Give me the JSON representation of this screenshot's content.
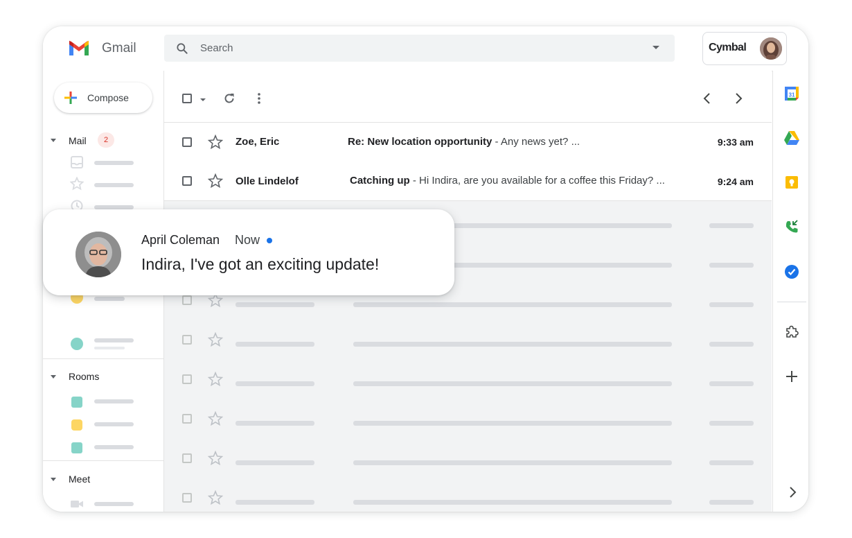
{
  "app": {
    "name": "Gmail"
  },
  "search": {
    "placeholder": "Search"
  },
  "account": {
    "org": "Cymbal"
  },
  "sidebar": {
    "compose_label": "Compose",
    "sections": {
      "mail": "Mail",
      "rooms": "Rooms",
      "meet": "Meet"
    },
    "mail_badge": "2"
  },
  "emails": [
    {
      "sender": "Zoe, Eric",
      "subject": "Re: New location opportunity",
      "snippet": " - Any news yet? ...",
      "time": "9:33 am"
    },
    {
      "sender": "Olle Lindelof",
      "subject": "Catching up",
      "snippet": " - Hi Indira, are you available for a coffee this Friday? ...",
      "time": "9:24 am"
    }
  ],
  "notification": {
    "sender": "April Coleman",
    "time": "Now",
    "message": "Indira, I've got an exciting update!"
  },
  "colors": {
    "accent_blue": "#1a73e8",
    "badge_bg": "#fce8e6",
    "badge_text": "#d93025",
    "room_teal": "#86d4c8",
    "room_yellow": "#fdd663"
  },
  "icons": {
    "rail": [
      "calendar-icon",
      "drive-icon",
      "keep-icon",
      "voice-icon",
      "tasks-icon",
      "addons-icon",
      "add-icon",
      "chevron-right-icon"
    ]
  }
}
